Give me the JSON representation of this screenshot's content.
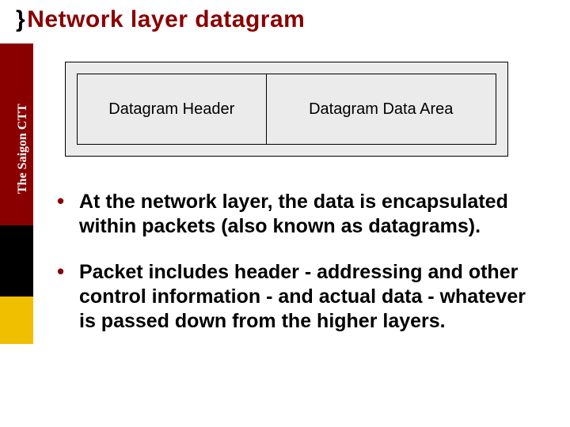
{
  "title": {
    "brace": "}",
    "text": "Network layer datagram"
  },
  "sidebar": {
    "label": "The Saigon CTT"
  },
  "diagram": {
    "header": "Datagram Header",
    "data": "Datagram Data Area"
  },
  "bullets": [
    "At the network layer, the data is encapsulated within packets (also known as datagrams).",
    "Packet includes header - addressing and other control information - and actual data - whatever is passed down from the higher layers."
  ]
}
